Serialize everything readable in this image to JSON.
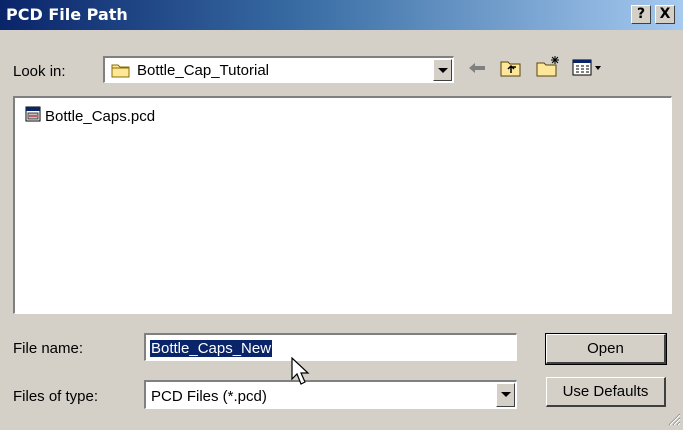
{
  "window": {
    "title": "PCD File Path",
    "help_label": "?",
    "close_label": "X"
  },
  "toolbar": {
    "look_in_label": "Look in:",
    "look_in_value": "Bottle_Cap_Tutorial",
    "icons": [
      "folder-icon",
      "back-arrow-icon",
      "up-folder-icon",
      "new-folder-icon",
      "view-menu-icon"
    ]
  },
  "files": [
    {
      "name": "Bottle_Caps.pcd",
      "icon": "pcd-file-icon"
    }
  ],
  "form": {
    "file_name_label": "File name:",
    "file_name_value": "Bottle_Caps_New",
    "files_of_type_label": "Files of type:",
    "files_of_type_value": "PCD Files (*.pcd)"
  },
  "buttons": {
    "open": "Open",
    "use_defaults": "Use Defaults"
  },
  "colors": {
    "title_start": "#0a246a",
    "title_end": "#a6caf0",
    "face": "#d4d0c8",
    "selection": "#0a246a"
  }
}
